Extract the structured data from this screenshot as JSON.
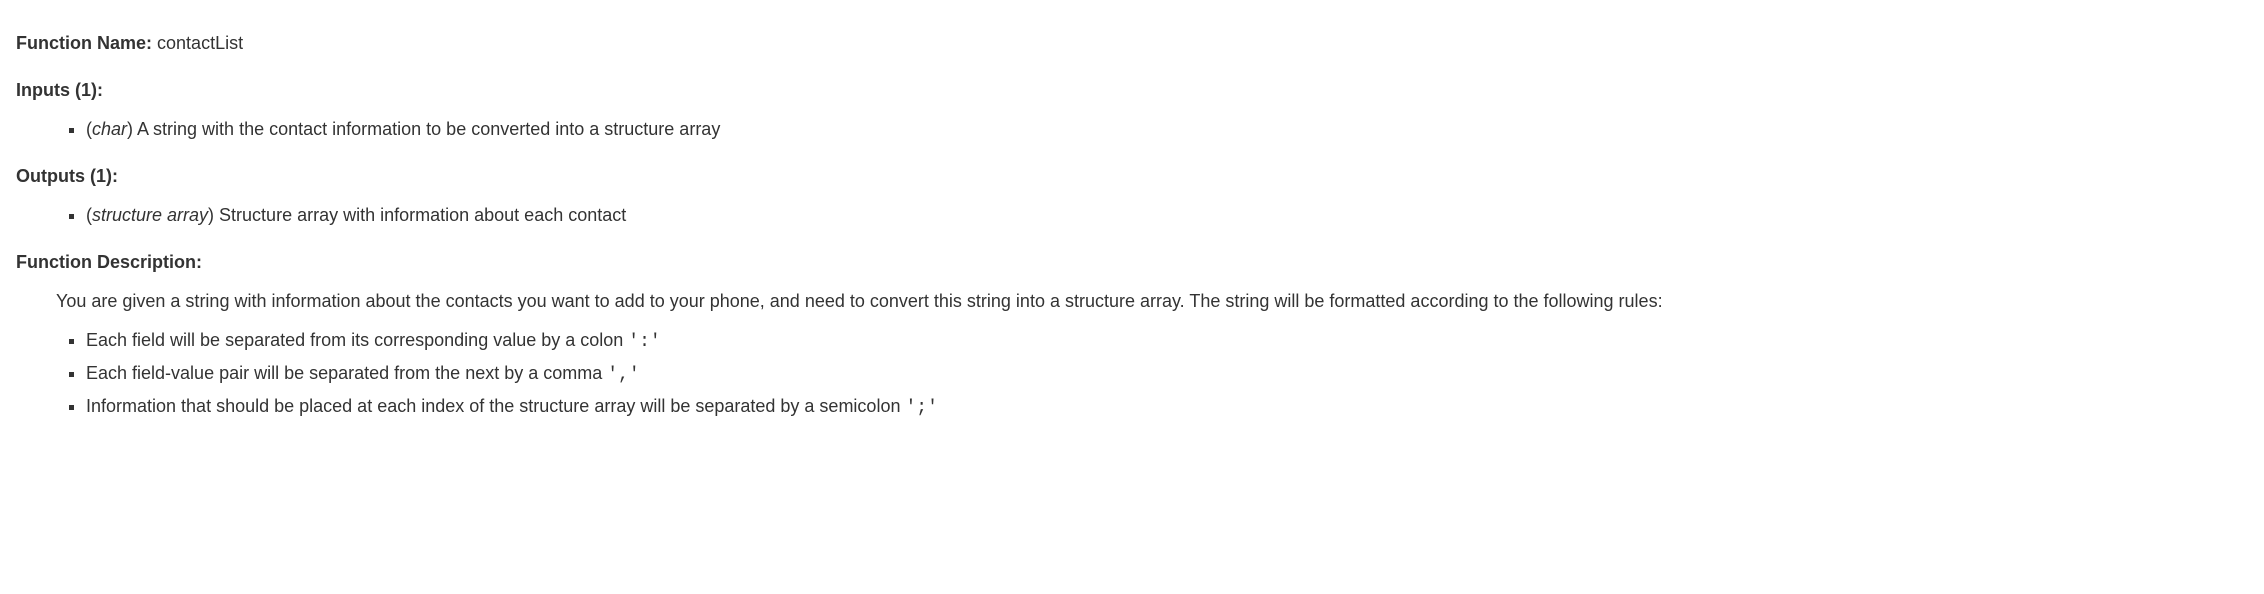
{
  "functionNameLabel": "Function Name:",
  "functionNameValue": "contactList",
  "inputsHeader": "Inputs (1):",
  "inputs": {
    "item1": {
      "openParen": "(",
      "type": "char",
      "closeParen": ")",
      "description": " A string with the contact information to be converted into a structure array"
    }
  },
  "outputsHeader": "Outputs (1):",
  "outputs": {
    "item1": {
      "openParen": "(",
      "type": "structure array",
      "closeParen": ")",
      "description": " Structure array with information about each contact"
    }
  },
  "descriptionHeader": "Function Description:",
  "descriptionParagraph": "You are given a string with information about the contacts you want to add to your phone, and need to convert this string into a structure array. The string will be formatted according to the following rules:",
  "rules": {
    "item1": {
      "textBefore": "Each field will be separated from its corresponding value by a colon ",
      "code": "':'"
    },
    "item2": {
      "textBefore": "Each field-value pair will be separated from the next by a comma ",
      "code": "','"
    },
    "item3": {
      "textBefore": "Information that should be placed at each index of the structure array will be separated by a semicolon ",
      "code": "';'"
    }
  }
}
